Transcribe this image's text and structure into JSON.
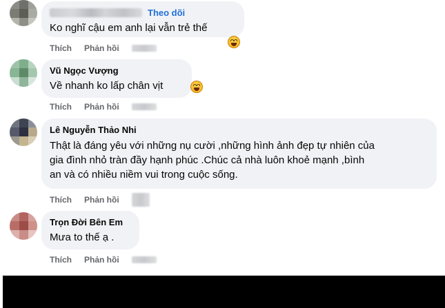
{
  "comments": [
    {
      "name": "",
      "follow_label": "Theo dõi",
      "lines": [
        "Ko nghĩ cậu em anh lại vẫn trẻ thế"
      ],
      "like_label": "Thích",
      "reply_label": "Phản hồi",
      "emoji": "grinning-squint-emoji"
    },
    {
      "name": "Vũ Ngọc Vượng",
      "lines": [
        "Về nhanh ko lấp chân vịt"
      ],
      "like_label": "Thích",
      "reply_label": "Phản hồi",
      "emoji": "grinning-squint-emoji"
    },
    {
      "name": "Lê Nguyễn Thảo Nhi",
      "lines": [
        "Thật là đáng yêu với những nụ cười ,những hình ảnh đẹp tự nhiên của",
        "gia đình nhỏ tràn đầy hạnh phúc .Chúc cả nhà luôn khoẻ mạnh ,bình",
        "an và có nhiều niềm vui trong cuộc sống."
      ],
      "like_label": "Thích",
      "reply_label": "Phản hồi"
    },
    {
      "name": "Trọn Đời Bên Em",
      "lines": [
        "Mưa to thế ạ ."
      ],
      "like_label": "Thích",
      "reply_label": "Phản hồi"
    }
  ],
  "colors": {
    "bubble": "#f0f2f5",
    "follow": "#216fdb",
    "action": "#65676b"
  }
}
